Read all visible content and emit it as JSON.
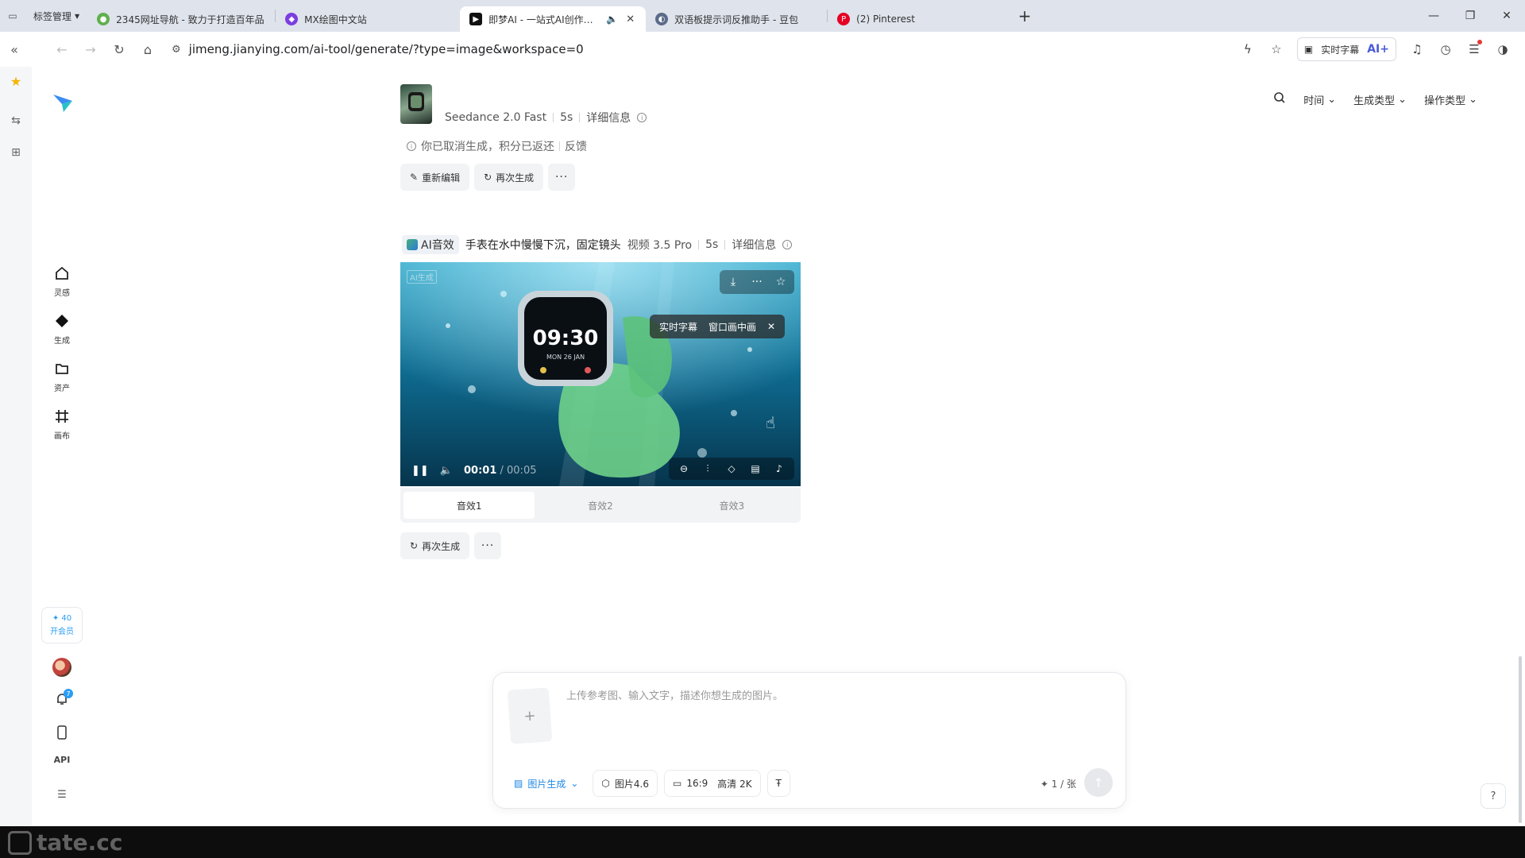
{
  "browser": {
    "bookmark_manager": "标签管理",
    "tabs": [
      {
        "title": "2345网址导航 - 致力于打造百年品",
        "active": false
      },
      {
        "title": "MX绘图中文站",
        "active": false
      },
      {
        "title": "即梦AI - 一站式AI创作平台",
        "active": true
      },
      {
        "title": "双语板提示词反推助手 - 豆包",
        "active": false
      },
      {
        "title": "(2) Pinterest",
        "active": false
      }
    ],
    "url": "jimeng.jianying.com/ai-tool/generate/?type=image&workspace=0",
    "toolbar_caption": "实时字幕",
    "toolbar_ai": "AI+"
  },
  "nav": {
    "items": [
      {
        "label": "灵感",
        "icon": "home-icon"
      },
      {
        "label": "生成",
        "icon": "diamond-icon"
      },
      {
        "label": "资产",
        "icon": "folder-icon"
      },
      {
        "label": "画布",
        "icon": "canvas-icon"
      }
    ],
    "credits": "40",
    "vip_label": "开会员",
    "notifications": "7",
    "api_label": "API"
  },
  "filters": {
    "time": "时间",
    "gen_type": "生成类型",
    "op_type": "操作类型"
  },
  "item1": {
    "model": "Seedance 2.0 Fast",
    "duration": "5s",
    "details": "详细信息",
    "notice": "你已取消生成，积分已返还",
    "feedback": "反馈",
    "btn_edit": "重新编辑",
    "btn_regen": "再次生成"
  },
  "item2": {
    "tag": "AI音效",
    "prompt": "手表在水中慢慢下沉，固定镜头",
    "model": "视频 3.5 Pro",
    "duration": "5s",
    "details": "详细信息",
    "video": {
      "time_current": "00:01",
      "time_total": " / 00:05",
      "pip_caption": "实时字幕",
      "pip_window": "窗口画中画",
      "watch_time": "09:30",
      "watch_date": "MON 26 JAN",
      "watermark": "AI生成"
    },
    "sfx_tabs": [
      "音效1",
      "音效2",
      "音效3"
    ],
    "btn_regen": "再次生成"
  },
  "composer": {
    "placeholder": "上传参考图、输入文字，描述你想生成的图片。",
    "mode": "图片生成",
    "model": "图片4.6",
    "ratio": "16:9",
    "quality": "高清 2K",
    "credits": "1 / 张"
  },
  "watermark": "tate.cc",
  "colors": {
    "accent": "#1e88e5",
    "water": "#0b4f6e",
    "band": "#6fd08a"
  }
}
